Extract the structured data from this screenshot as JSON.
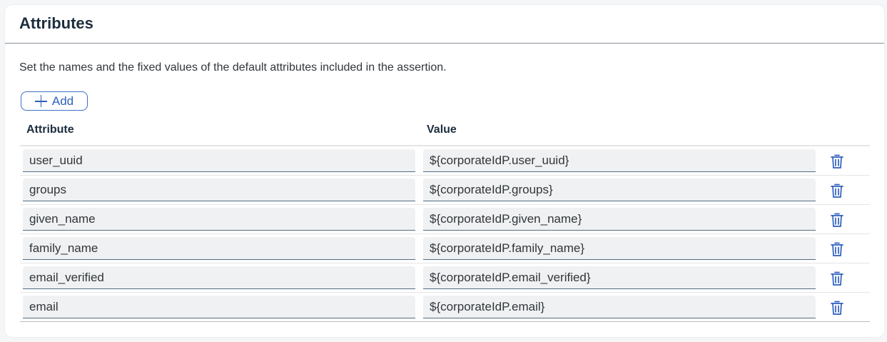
{
  "panel": {
    "title": "Attributes",
    "description": "Set the names and the fixed values of the default attributes included in the assertion."
  },
  "toolbar": {
    "add_label": "Add",
    "add_icon": "plus-icon"
  },
  "table": {
    "columns": [
      "Attribute",
      "Value"
    ],
    "rows": [
      {
        "attribute": "user_uuid",
        "value": "${corporateIdP.user_uuid}"
      },
      {
        "attribute": "groups",
        "value": "${corporateIdP.groups}"
      },
      {
        "attribute": "given_name",
        "value": "${corporateIdP.given_name}"
      },
      {
        "attribute": "family_name",
        "value": "${corporateIdP.family_name}"
      },
      {
        "attribute": "email_verified",
        "value": "${corporateIdP.email_verified}"
      },
      {
        "attribute": "email",
        "value": "${corporateIdP.email}"
      }
    ],
    "row_action_icon": "trash-icon"
  },
  "colors": {
    "accent": "#2d5fbe",
    "input_background": "#eff1f2",
    "title_text": "#1d2d3e"
  }
}
